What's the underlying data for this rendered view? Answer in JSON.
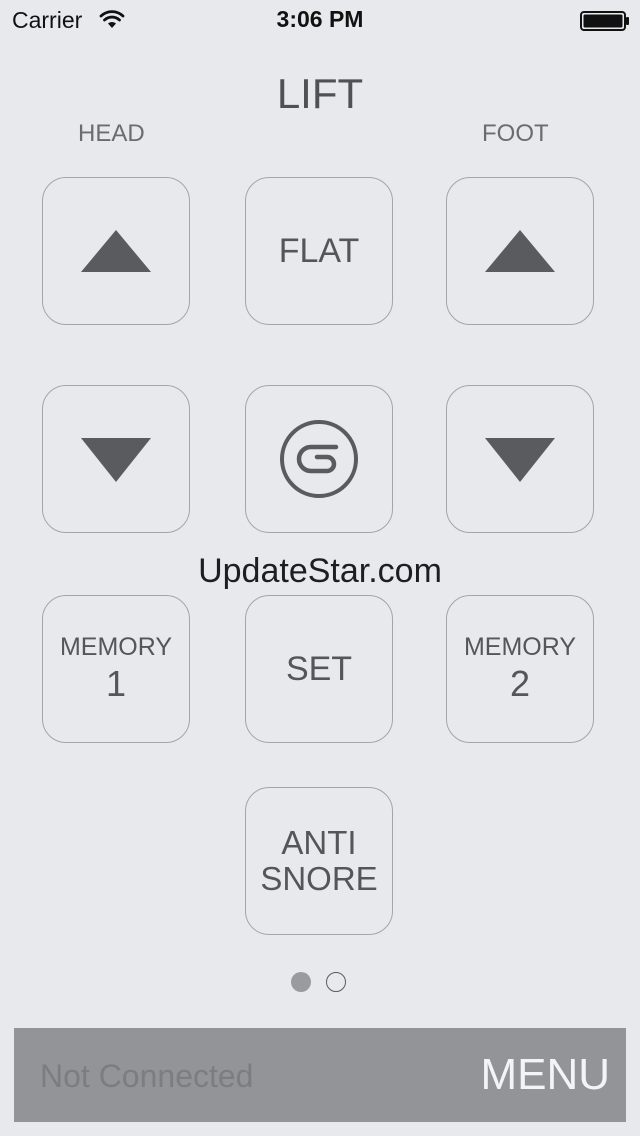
{
  "status_bar": {
    "carrier": "Carrier",
    "time": "3:06 PM"
  },
  "screen": {
    "title": "LIFT",
    "head_label": "HEAD",
    "foot_label": "FOOT"
  },
  "buttons": {
    "head_up_icon": "triangle-up-icon",
    "foot_up_icon": "triangle-up-icon",
    "head_down_icon": "triangle-down-icon",
    "foot_down_icon": "triangle-down-icon",
    "flat": "FLAT",
    "logo_icon": "brand-logo-icon",
    "memory1_label": "MEMORY",
    "memory1_num": "1",
    "set": "SET",
    "memory2_label": "MEMORY",
    "memory2_num": "2",
    "anti": "ANTI",
    "snore": "SNORE"
  },
  "watermark": "UpdateStar.com",
  "pager": {
    "pages": 2,
    "active_index": 0
  },
  "bottom_bar": {
    "status": "Not Connected",
    "menu": "MENU"
  },
  "colors": {
    "background": "#e8e9ec",
    "button_border": "#a4a5a9",
    "icon": "#5a5b5f",
    "bottom_bar": "#939498",
    "menu_text": "#f4f4f6"
  }
}
